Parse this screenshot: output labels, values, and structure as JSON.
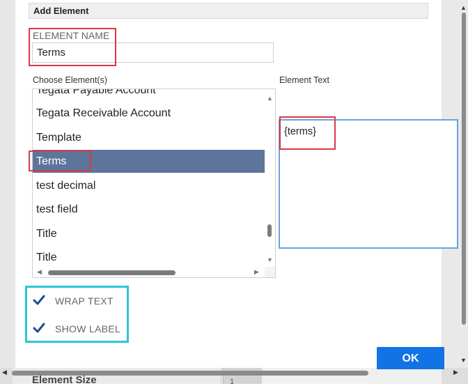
{
  "dialog": {
    "title": "Add Element",
    "element_name_label": "ELEMENT NAME",
    "element_name_value": "Terms",
    "choose_label": "Choose Element(s)",
    "element_text_label": "Element Text",
    "element_text_value": "{terms}",
    "list_items": [
      {
        "label": "Tegata Payable Account",
        "selected": false
      },
      {
        "label": "Tegata Receivable Account",
        "selected": false
      },
      {
        "label": "Template",
        "selected": false
      },
      {
        "label": "Terms",
        "selected": true
      },
      {
        "label": "test decimal",
        "selected": false
      },
      {
        "label": "test field",
        "selected": false
      },
      {
        "label": "Title",
        "selected": false
      },
      {
        "label": "Title",
        "selected": false
      }
    ],
    "wrap_text": {
      "label": "WRAP TEXT",
      "checked": true
    },
    "show_label": {
      "label": "SHOW LABEL",
      "checked": true
    },
    "ok_label": "OK"
  },
  "background": {
    "section_label": "Element Size",
    "stepper_value": "1"
  },
  "colors": {
    "selected_row": "#5e759b",
    "ok_button": "#1173e5",
    "highlight_red": "#d83a41",
    "highlight_cyan": "#2bc6da",
    "textarea_focus": "#6aa2dd",
    "checkmark": "#1d4a94"
  },
  "icons": {
    "scroll_up": "▲",
    "scroll_down": "▼",
    "scroll_left": "◀",
    "scroll_right": "▶",
    "checkbox": "checkbox-checked-icon"
  }
}
